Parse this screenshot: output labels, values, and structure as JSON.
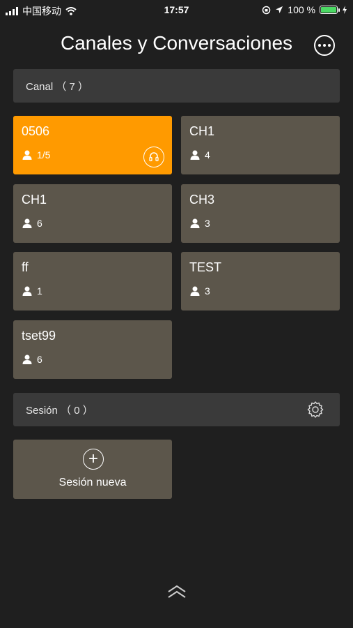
{
  "status_bar": {
    "carrier": "中国移动",
    "time": "17:57",
    "battery_pct": "100 %"
  },
  "header": {
    "title": "Canales y Conversaciones"
  },
  "channel_section": {
    "label": "Canal （ 7 ）"
  },
  "channels": [
    {
      "name": "0506",
      "members": "1/5",
      "active": true
    },
    {
      "name": "CH1",
      "members": "4",
      "active": false
    },
    {
      "name": "CH1",
      "members": "6",
      "active": false
    },
    {
      "name": "CH3",
      "members": "3",
      "active": false
    },
    {
      "name": "ff",
      "members": "1",
      "active": false
    },
    {
      "name": "TEST",
      "members": "3",
      "active": false
    },
    {
      "name": "tset99",
      "members": "6",
      "active": false
    }
  ],
  "session_section": {
    "label": "Sesión （ 0 ）"
  },
  "new_session": {
    "label": "Sesión nueva"
  },
  "colors": {
    "background": "#1f1f1f",
    "card": "#5c564b",
    "active_card": "#ff9a00",
    "section_bar": "#3a3a3a"
  },
  "icons": {
    "more": "ellipsis-icon",
    "person": "person-icon",
    "talk": "headset-icon",
    "gear": "gear-icon",
    "plus": "plus-icon",
    "chevron": "chevron-up-double-icon"
  }
}
